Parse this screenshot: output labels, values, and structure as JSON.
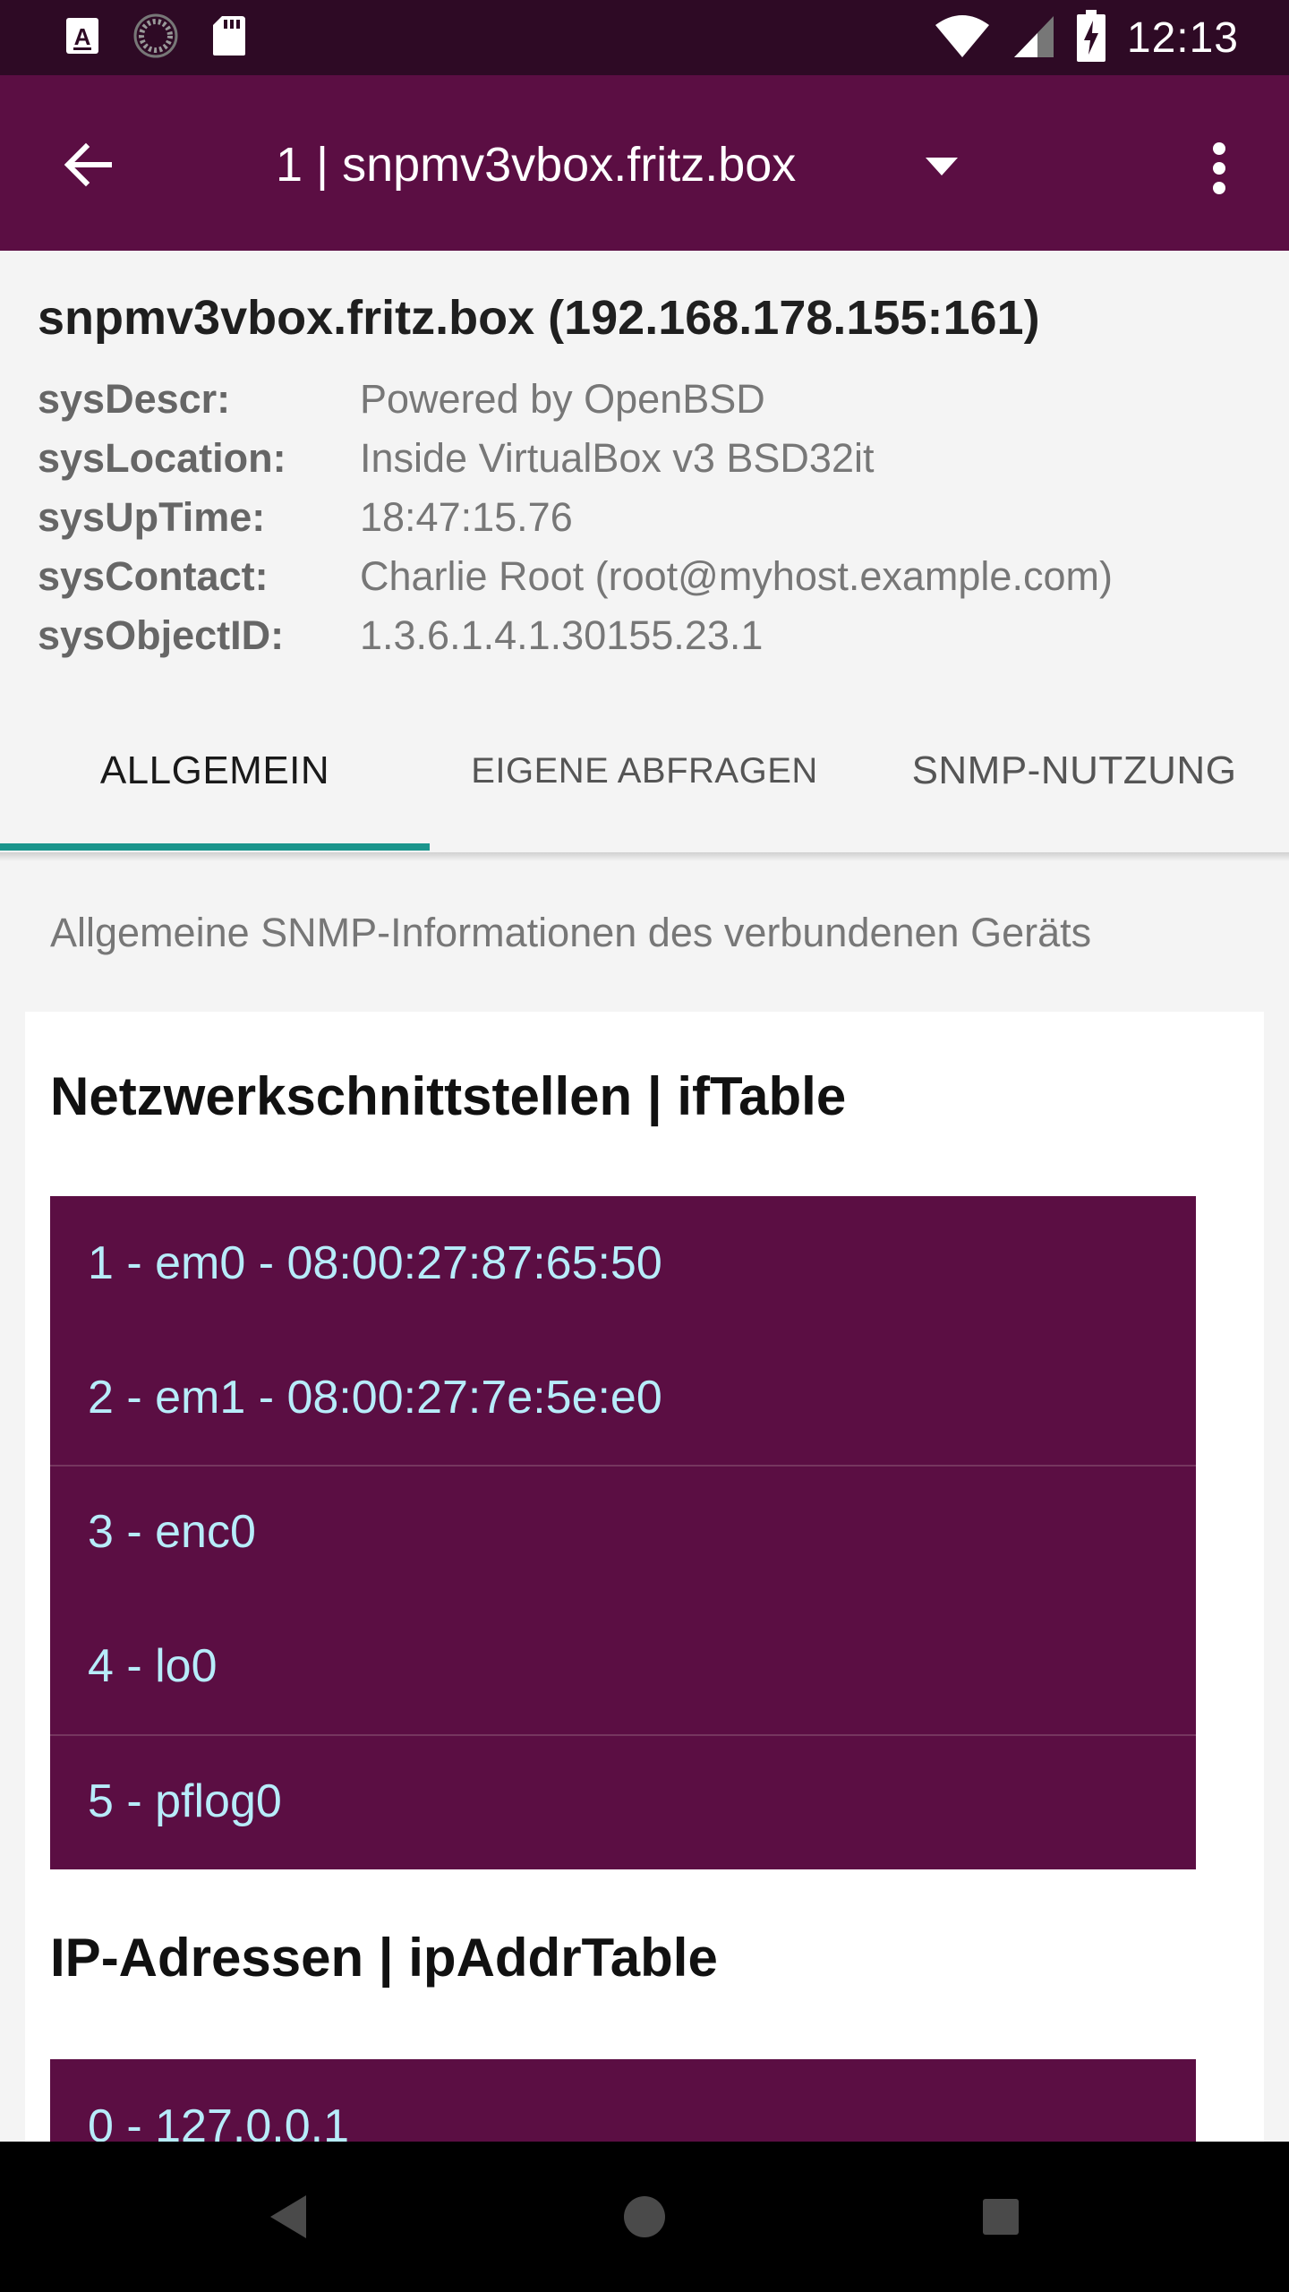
{
  "status_bar": {
    "time": "12:13",
    "left_icons": [
      "a-keyboard-icon",
      "loading-icon",
      "sd-card-icon"
    ],
    "right_icons": [
      "wifi-icon",
      "signal-icon",
      "battery-charging-icon"
    ]
  },
  "app_bar": {
    "title": "1 | snpmv3vbox.fritz.box"
  },
  "device": {
    "title": "snpmv3vbox.fritz.box (192.168.178.155:161)",
    "info": [
      {
        "label": "sysDescr:",
        "value": "Powered by OpenBSD"
      },
      {
        "label": "sysLocation:",
        "value": "Inside VirtualBox v3 BSD32it"
      },
      {
        "label": "sysUpTime:",
        "value": "18:47:15.76"
      },
      {
        "label": "sysContact:",
        "value": "Charlie Root (root@myhost.example.com)"
      },
      {
        "label": "sysObjectID:",
        "value": "1.3.6.1.4.1.30155.23.1"
      }
    ]
  },
  "tabs": [
    {
      "label": "ALLGEMEIN",
      "active": true
    },
    {
      "label": "EIGENE ABFRAGEN",
      "active": false
    },
    {
      "label": "SNMP-NUTZUNG",
      "active": false
    }
  ],
  "content": {
    "description": "Allgemeine SNMP-Informationen des verbundenen Geräts",
    "sections": [
      {
        "title": "Netzwerkschnittstellen | ifTable",
        "items": [
          "1 - em0 - 08:00:27:87:65:50",
          "2 - em1 - 08:00:27:7e:5e:e0",
          "3 - enc0",
          "4 - lo0",
          "5 - pflog0"
        ]
      },
      {
        "title": "IP-Adressen | ipAddrTable",
        "items": [
          "0 - 127.0.0.1"
        ]
      }
    ]
  },
  "colors": {
    "status_bar": "#2e0a25",
    "primary": "#5b0e43",
    "accent": "#1a958c",
    "list_text": "#b7ecfa"
  }
}
